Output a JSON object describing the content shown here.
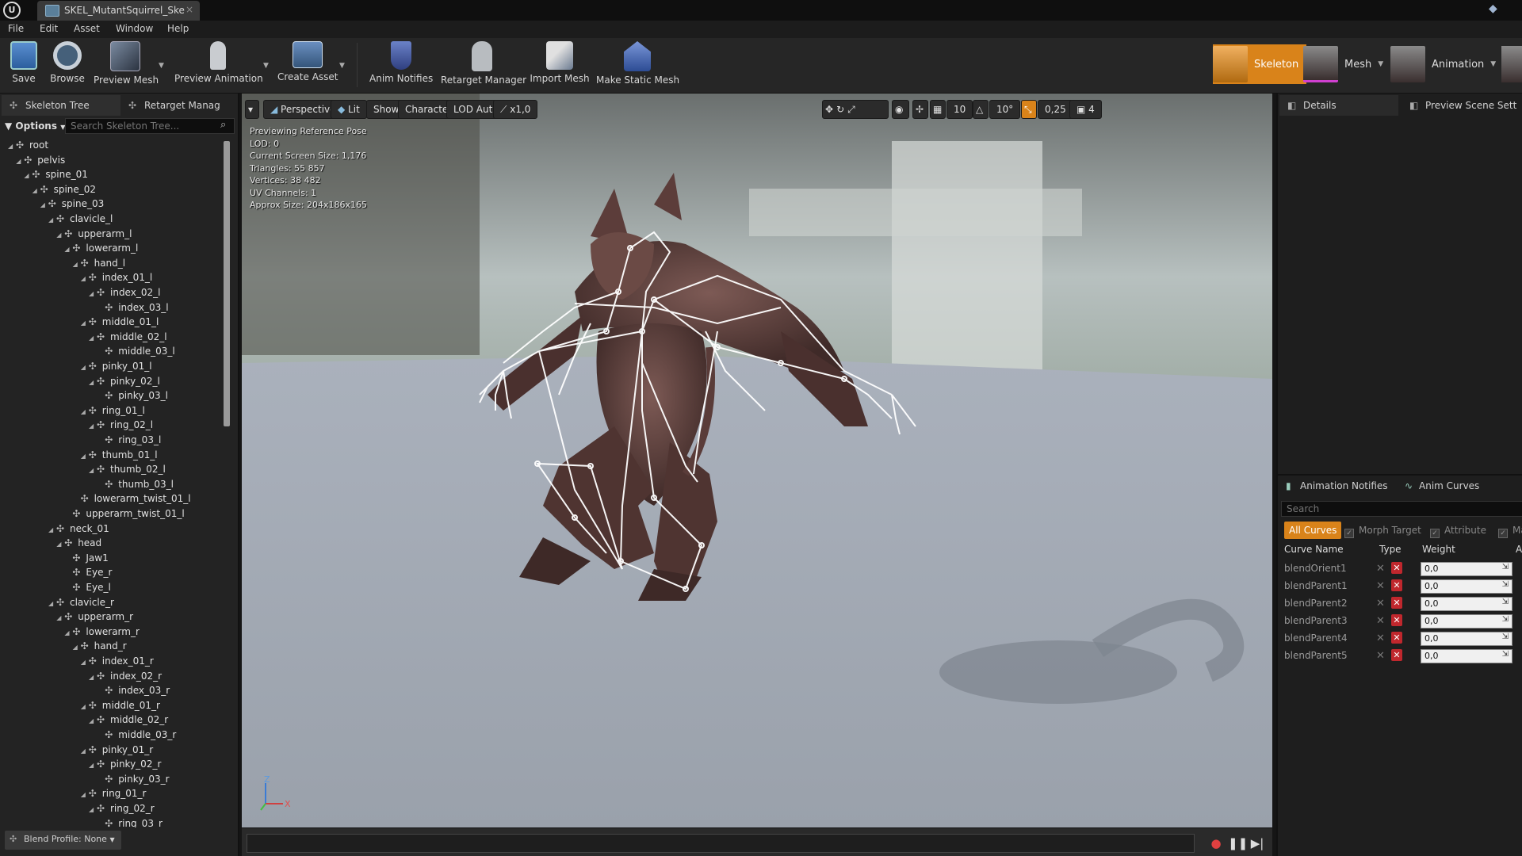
{
  "window": {
    "tab_title": "SKEL_MutantSquirrel_Ske",
    "logo": "U",
    "close_glyph": "×"
  },
  "menu": [
    "File",
    "Edit",
    "Asset",
    "Window",
    "Help"
  ],
  "toolbar": {
    "buttons": [
      "Save",
      "Browse",
      "Preview Mesh",
      "Preview Animation",
      "Create Asset",
      "Anim Notifies",
      "Retarget Manager",
      "Import Mesh",
      "Make Static Mesh"
    ],
    "modes": [
      "Skeleton",
      "Mesh",
      "Animation"
    ]
  },
  "left_panel": {
    "tabs": [
      "Skeleton Tree",
      "Retarget Manage"
    ],
    "options_label": "Options",
    "search_placeholder": "Search Skeleton Tree...",
    "blend_profile": "Blend Profile: None",
    "bones": [
      {
        "name": "root",
        "depth": 0,
        "arrow": true
      },
      {
        "name": "pelvis",
        "depth": 1,
        "arrow": true
      },
      {
        "name": "spine_01",
        "depth": 2,
        "arrow": true
      },
      {
        "name": "spine_02",
        "depth": 3,
        "arrow": true
      },
      {
        "name": "spine_03",
        "depth": 4,
        "arrow": true
      },
      {
        "name": "clavicle_l",
        "depth": 5,
        "arrow": true
      },
      {
        "name": "upperarm_l",
        "depth": 6,
        "arrow": true
      },
      {
        "name": "lowerarm_l",
        "depth": 7,
        "arrow": true
      },
      {
        "name": "hand_l",
        "depth": 8,
        "arrow": true
      },
      {
        "name": "index_01_l",
        "depth": 9,
        "arrow": true
      },
      {
        "name": "index_02_l",
        "depth": 10,
        "arrow": true
      },
      {
        "name": "index_03_l",
        "depth": 11,
        "arrow": false
      },
      {
        "name": "middle_01_l",
        "depth": 9,
        "arrow": true
      },
      {
        "name": "middle_02_l",
        "depth": 10,
        "arrow": true
      },
      {
        "name": "middle_03_l",
        "depth": 11,
        "arrow": false
      },
      {
        "name": "pinky_01_l",
        "depth": 9,
        "arrow": true
      },
      {
        "name": "pinky_02_l",
        "depth": 10,
        "arrow": true
      },
      {
        "name": "pinky_03_l",
        "depth": 11,
        "arrow": false
      },
      {
        "name": "ring_01_l",
        "depth": 9,
        "arrow": true
      },
      {
        "name": "ring_02_l",
        "depth": 10,
        "arrow": true
      },
      {
        "name": "ring_03_l",
        "depth": 11,
        "arrow": false
      },
      {
        "name": "thumb_01_l",
        "depth": 9,
        "arrow": true
      },
      {
        "name": "thumb_02_l",
        "depth": 10,
        "arrow": true
      },
      {
        "name": "thumb_03_l",
        "depth": 11,
        "arrow": false
      },
      {
        "name": "lowerarm_twist_01_l",
        "depth": 8,
        "arrow": false
      },
      {
        "name": "upperarm_twist_01_l",
        "depth": 7,
        "arrow": false
      },
      {
        "name": "neck_01",
        "depth": 5,
        "arrow": true
      },
      {
        "name": "head",
        "depth": 6,
        "arrow": true
      },
      {
        "name": "Jaw1",
        "depth": 7,
        "arrow": false
      },
      {
        "name": "Eye_r",
        "depth": 7,
        "arrow": false
      },
      {
        "name": "Eye_l",
        "depth": 7,
        "arrow": false
      },
      {
        "name": "clavicle_r",
        "depth": 5,
        "arrow": true
      },
      {
        "name": "upperarm_r",
        "depth": 6,
        "arrow": true
      },
      {
        "name": "lowerarm_r",
        "depth": 7,
        "arrow": true
      },
      {
        "name": "hand_r",
        "depth": 8,
        "arrow": true
      },
      {
        "name": "index_01_r",
        "depth": 9,
        "arrow": true
      },
      {
        "name": "index_02_r",
        "depth": 10,
        "arrow": true
      },
      {
        "name": "index_03_r",
        "depth": 11,
        "arrow": false
      },
      {
        "name": "middle_01_r",
        "depth": 9,
        "arrow": true
      },
      {
        "name": "middle_02_r",
        "depth": 10,
        "arrow": true
      },
      {
        "name": "middle_03_r",
        "depth": 11,
        "arrow": false
      },
      {
        "name": "pinky_01_r",
        "depth": 9,
        "arrow": true
      },
      {
        "name": "pinky_02_r",
        "depth": 10,
        "arrow": true
      },
      {
        "name": "pinky_03_r",
        "depth": 11,
        "arrow": false
      },
      {
        "name": "ring_01_r",
        "depth": 9,
        "arrow": true
      },
      {
        "name": "ring_02_r",
        "depth": 10,
        "arrow": true
      },
      {
        "name": "ring_03_r",
        "depth": 11,
        "arrow": false
      }
    ]
  },
  "viewport": {
    "toolbar": {
      "perspective": "Perspective",
      "lit": "Lit",
      "show": "Show",
      "character": "Character",
      "lod": "LOD Auto",
      "speed": "x1,0",
      "grid_snap": "10",
      "angle_snap": "10°",
      "scale_snap": "0,25",
      "camera_speed": "4"
    },
    "stats": [
      "Previewing Reference Pose",
      "LOD: 0",
      "Current Screen Size: 1,176",
      "Triangles: 55 857",
      "Vertices: 38 482",
      "UV Channels: 1",
      "Approx Size: 204x186x165"
    ],
    "axis": {
      "z": "Z",
      "x": "X"
    }
  },
  "right_panel": {
    "tabs": [
      "Details",
      "Preview Scene Sett"
    ],
    "curve_tabs": [
      "Animation Notifies",
      "Anim Curves"
    ],
    "curve_search_placeholder": "Search",
    "filters": [
      "All Curves",
      "Morph Target",
      "Attribute",
      "Ma"
    ],
    "columns": [
      "Curve Name",
      "Type",
      "Weight",
      "A"
    ],
    "curves": [
      {
        "name": "blendOrient1",
        "weight": "0,0"
      },
      {
        "name": "blendParent1",
        "weight": "0,0"
      },
      {
        "name": "blendParent2",
        "weight": "0,0"
      },
      {
        "name": "blendParent3",
        "weight": "0,0"
      },
      {
        "name": "blendParent4",
        "weight": "0,0"
      },
      {
        "name": "blendParent5",
        "weight": "0,0"
      }
    ]
  },
  "colors": {
    "accent": "#d9831a",
    "panel": "#232323",
    "viewport_floor": "#a9afb8"
  }
}
